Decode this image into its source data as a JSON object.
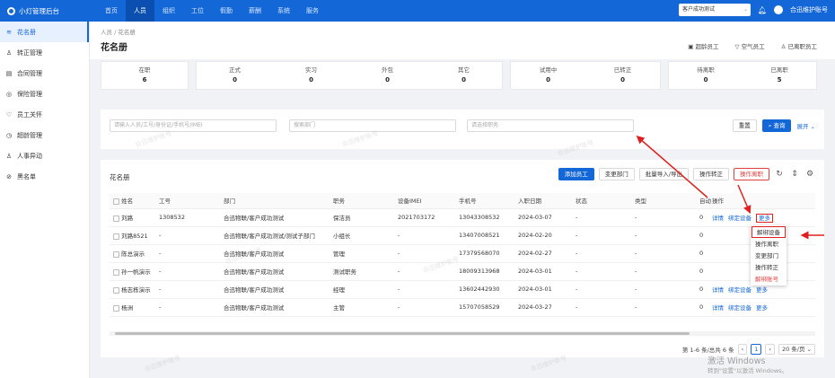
{
  "app": {
    "title": "小灯管理后台"
  },
  "nav": [
    "首页",
    "人员",
    "组织",
    "工位",
    "假勤",
    "薪酬",
    "系统",
    "服务"
  ],
  "topbar": {
    "company": "客户成功测试",
    "user": "合迅维护账号"
  },
  "sidebar": [
    {
      "icon": "roster-icon",
      "glyph": "≋",
      "label": "花名册"
    },
    {
      "icon": "user-icon",
      "glyph": "♙",
      "label": "转正管理"
    },
    {
      "icon": "contract-icon",
      "glyph": "▤",
      "label": "合同管理"
    },
    {
      "icon": "insurance-icon",
      "glyph": "◎",
      "label": "保险管理"
    },
    {
      "icon": "care-icon",
      "glyph": "♡",
      "label": "员工关怀"
    },
    {
      "icon": "age-icon",
      "glyph": "◷",
      "label": "超龄管理"
    },
    {
      "icon": "transfer-icon",
      "glyph": "♙",
      "label": "人事异动"
    },
    {
      "icon": "blacklist-icon",
      "glyph": "⊘",
      "label": "黑名单"
    }
  ],
  "header": {
    "breadcrumb": "人员 / 花名册",
    "title": "花名册",
    "actions": [
      "超龄员工",
      "空气员工",
      "已离职员工"
    ]
  },
  "stats": [
    [
      {
        "label": "在职",
        "value": "6"
      }
    ],
    [
      {
        "label": "正式",
        "value": "0"
      },
      {
        "label": "实习",
        "value": "0"
      },
      {
        "label": "外包",
        "value": "0"
      },
      {
        "label": "其它",
        "value": "0"
      }
    ],
    [
      {
        "label": "试用中",
        "value": "0"
      },
      {
        "label": "已转正",
        "value": "0"
      }
    ],
    [
      {
        "label": "待离职",
        "value": "0"
      },
      {
        "label": "已离职",
        "value": "5"
      }
    ]
  ],
  "filter": {
    "ph_person": "请输入人员/工号/身份证/手机号/IMEI",
    "ph_dept": "搜索部门",
    "ph_post": "请选择职务",
    "reset": "重置",
    "query": "查询",
    "expand": "展开"
  },
  "table": {
    "title": "花名册",
    "buttons": {
      "add": "添加员工",
      "dept": "变更部门",
      "batch": "批量导入/导出",
      "convert": "操作转正",
      "resign": "操作离职"
    },
    "columns": [
      "姓名",
      "工号",
      "部门",
      "职务",
      "设备IMEI",
      "手机号",
      "入职日期",
      "状态",
      "类型",
      "自动",
      "操作"
    ],
    "rows": [
      {
        "name": "刘路",
        "no": "1308532",
        "dept": "合迅物联/客户成功测试",
        "post": "保洁员",
        "imei": "2021703172",
        "phone": "13043308532",
        "date": "2024-03-07",
        "status": "-",
        "type": "-",
        "auto": "0"
      },
      {
        "name": "刘路8521",
        "no": "-",
        "dept": "合迅物联/客户成功测试/测试子部门",
        "post": "小组长",
        "imei": "-",
        "phone": "13407008521",
        "date": "2024-02-20",
        "status": "-",
        "type": "-",
        "auto": "0"
      },
      {
        "name": "陈总演示",
        "no": "-",
        "dept": "合迅物联/客户成功测试",
        "post": "管理",
        "imei": "-",
        "phone": "17379568070",
        "date": "2024-02-27",
        "status": "-",
        "type": "-",
        "auto": "0"
      },
      {
        "name": "孙一帆演示",
        "no": "-",
        "dept": "合迅物联/客户成功测试",
        "post": "测试职务",
        "imei": "-",
        "phone": "18009313968",
        "date": "2024-03-01",
        "status": "-",
        "type": "-",
        "auto": "0"
      },
      {
        "name": "杨志栋演示",
        "no": "-",
        "dept": "合迅物联/客户成功测试",
        "post": "经理",
        "imei": "-",
        "phone": "13602442930",
        "date": "2024-03-01",
        "status": "-",
        "type": "-",
        "auto": "0"
      },
      {
        "name": "杨洲",
        "no": "-",
        "dept": "合迅物联/客户成功测试",
        "post": "主管",
        "imei": "-",
        "phone": "15707058529",
        "date": "2024-03-27",
        "status": "-",
        "type": "-",
        "auto": "0"
      }
    ],
    "ops": {
      "detail": "详情",
      "bind": "绑定设备",
      "more": "更多"
    }
  },
  "dropdown": [
    "解绑设备",
    "操作离职",
    "变更部门",
    "操作转正",
    "解绑账号"
  ],
  "pager": {
    "summary": "第 1-6 条/总共 6 条",
    "page": "1",
    "size": "20 条/页"
  },
  "watermark": "合迅维护账号",
  "windows": {
    "line1": "激活 Windows",
    "line2": "转到\"设置\"以激活 Windows。"
  }
}
